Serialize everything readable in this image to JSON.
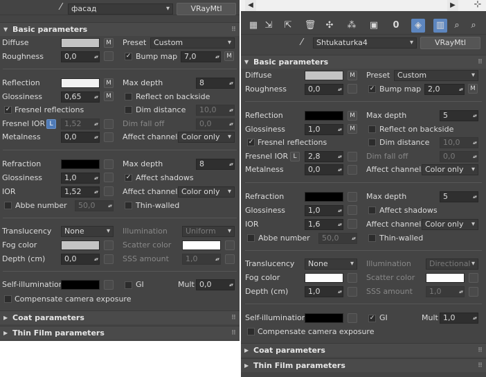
{
  "left": {
    "material_name": "фасад",
    "material_type": "VRayMtl",
    "section_title": "Basic parameters",
    "diffuse": {
      "label": "Diffuse",
      "color": "#c4c4c4",
      "m": "M"
    },
    "preset": {
      "label": "Preset",
      "value": "Custom"
    },
    "roughness": {
      "label": "Roughness",
      "value": "0,0"
    },
    "bump_map": {
      "label": "Bump map",
      "value": "7,0",
      "m": "M",
      "checked": true
    },
    "reflection": {
      "label": "Reflection",
      "color": "#f2f2f2",
      "m": "M"
    },
    "max_depth": {
      "label": "Max depth",
      "value": "8"
    },
    "glossiness": {
      "label": "Glossiness",
      "value": "0,65",
      "m": "M"
    },
    "reflect_backside": {
      "label": "Reflect on backside",
      "checked": false
    },
    "fresnel": {
      "label": "Fresnel reflections",
      "checked": true
    },
    "dim_distance": {
      "label": "Dim distance",
      "value": "10,0",
      "checked": false
    },
    "fresnel_ior": {
      "label": "Fresnel IOR",
      "l": "L",
      "value": "1,52"
    },
    "dim_falloff": {
      "label": "Dim fall off",
      "value": "0,0"
    },
    "metalness": {
      "label": "Metalness",
      "value": "0,0"
    },
    "affect_channels": {
      "label": "Affect channels",
      "value": "Color only"
    },
    "refraction": {
      "label": "Refraction",
      "color": "#000000"
    },
    "refr_max_depth": {
      "label": "Max depth",
      "value": "8"
    },
    "refr_glossiness": {
      "label": "Glossiness",
      "value": "1,0"
    },
    "affect_shadows": {
      "label": "Affect shadows",
      "checked": true
    },
    "ior": {
      "label": "IOR",
      "value": "1,52"
    },
    "refr_affect_channels": {
      "label": "Affect channels",
      "value": "Color only"
    },
    "abbe": {
      "label": "Abbe number",
      "value": "50,0",
      "checked": false
    },
    "thin_walled": {
      "label": "Thin-walled",
      "checked": false
    },
    "translucency": {
      "label": "Translucency",
      "value": "None"
    },
    "illumination": {
      "label": "Illumination",
      "value": "Uniform"
    },
    "fog_color": {
      "label": "Fog color",
      "color": "#c4c4c4"
    },
    "scatter_color": {
      "label": "Scatter color",
      "color": "#ffffff"
    },
    "depth": {
      "label": "Depth (cm)",
      "value": "0,0"
    },
    "sss_amount": {
      "label": "SSS amount",
      "value": "1,0"
    },
    "self_illum": {
      "label": "Self-illumination",
      "color": "#000000"
    },
    "gi": {
      "label": "GI",
      "checked": false
    },
    "mult": {
      "label": "Mult",
      "value": "0,0"
    },
    "compensate": {
      "label": "Compensate camera exposure",
      "checked": false
    },
    "coat_title": "Coat parameters",
    "thin_film_title": "Thin Film parameters"
  },
  "right": {
    "material_name": "Shtukaturka4",
    "material_type": "VRayMtl",
    "section_title": "Basic parameters",
    "diffuse": {
      "label": "Diffuse",
      "color": "#c4c4c4",
      "m": "M"
    },
    "preset": {
      "label": "Preset",
      "value": "Custom"
    },
    "roughness": {
      "label": "Roughness",
      "value": "0,0"
    },
    "bump_map": {
      "label": "Bump map",
      "value": "2,0",
      "m": "M",
      "checked": true
    },
    "reflection": {
      "label": "Reflection",
      "color": "#000000",
      "m": "M"
    },
    "max_depth": {
      "label": "Max depth",
      "value": "5"
    },
    "glossiness": {
      "label": "Glossiness",
      "value": "1,0",
      "m": "M"
    },
    "reflect_backside": {
      "label": "Reflect on backside",
      "checked": false
    },
    "fresnel": {
      "label": "Fresnel reflections",
      "checked": true
    },
    "dim_distance": {
      "label": "Dim distance",
      "value": "10,0",
      "checked": false
    },
    "fresnel_ior": {
      "label": "Fresnel IOR",
      "l": "L",
      "value": "2,8"
    },
    "dim_falloff": {
      "label": "Dim fall off",
      "value": "0,0"
    },
    "metalness": {
      "label": "Metalness",
      "value": "0,0"
    },
    "affect_channels": {
      "label": "Affect channels",
      "value": "Color only"
    },
    "refraction": {
      "label": "Refraction",
      "color": "#000000"
    },
    "refr_max_depth": {
      "label": "Max depth",
      "value": "5"
    },
    "refr_glossiness": {
      "label": "Glossiness",
      "value": "1,0"
    },
    "affect_shadows": {
      "label": "Affect shadows",
      "checked": false
    },
    "ior": {
      "label": "IOR",
      "value": "1,6"
    },
    "refr_affect_channels": {
      "label": "Affect channels",
      "value": "Color only"
    },
    "abbe": {
      "label": "Abbe number",
      "value": "50,0",
      "checked": false
    },
    "thin_walled": {
      "label": "Thin-walled",
      "checked": false
    },
    "translucency": {
      "label": "Translucency",
      "value": "None"
    },
    "illumination": {
      "label": "Illumination",
      "value": "Directional"
    },
    "fog_color": {
      "label": "Fog color",
      "color": "#ffffff"
    },
    "scatter_color": {
      "label": "Scatter color",
      "color": "#ffffff"
    },
    "depth": {
      "label": "Depth (cm)",
      "value": "1,0"
    },
    "sss_amount": {
      "label": "SSS amount",
      "value": "1,0"
    },
    "self_illum": {
      "label": "Self-illumination",
      "color": "#000000"
    },
    "gi": {
      "label": "GI",
      "checked": true
    },
    "mult": {
      "label": "Mult",
      "value": "1,0"
    },
    "compensate": {
      "label": "Compensate camera exposure",
      "checked": false
    },
    "coat_title": "Coat parameters",
    "thin_film_title": "Thin Film parameters",
    "toolbar_icons": [
      "sample-type-icon",
      "get-material-icon",
      "put-to-scene-icon",
      "delete-icon",
      "make-unique-icon",
      "assign-material-icon",
      "save-library-icon",
      "material-id-icon",
      "show-in-viewport-icon",
      "show-end-result-icon",
      "go-to-parent-icon",
      "go-forward-icon"
    ],
    "material_id": "0"
  },
  "glyphs": {
    "check": "✓",
    "eyedropper": "⁄",
    "expanded": "▼",
    "collapsed": "▶",
    "grip": "⠿",
    "nav_left": "◀",
    "nav_right": "▶",
    "more": "⊹"
  }
}
